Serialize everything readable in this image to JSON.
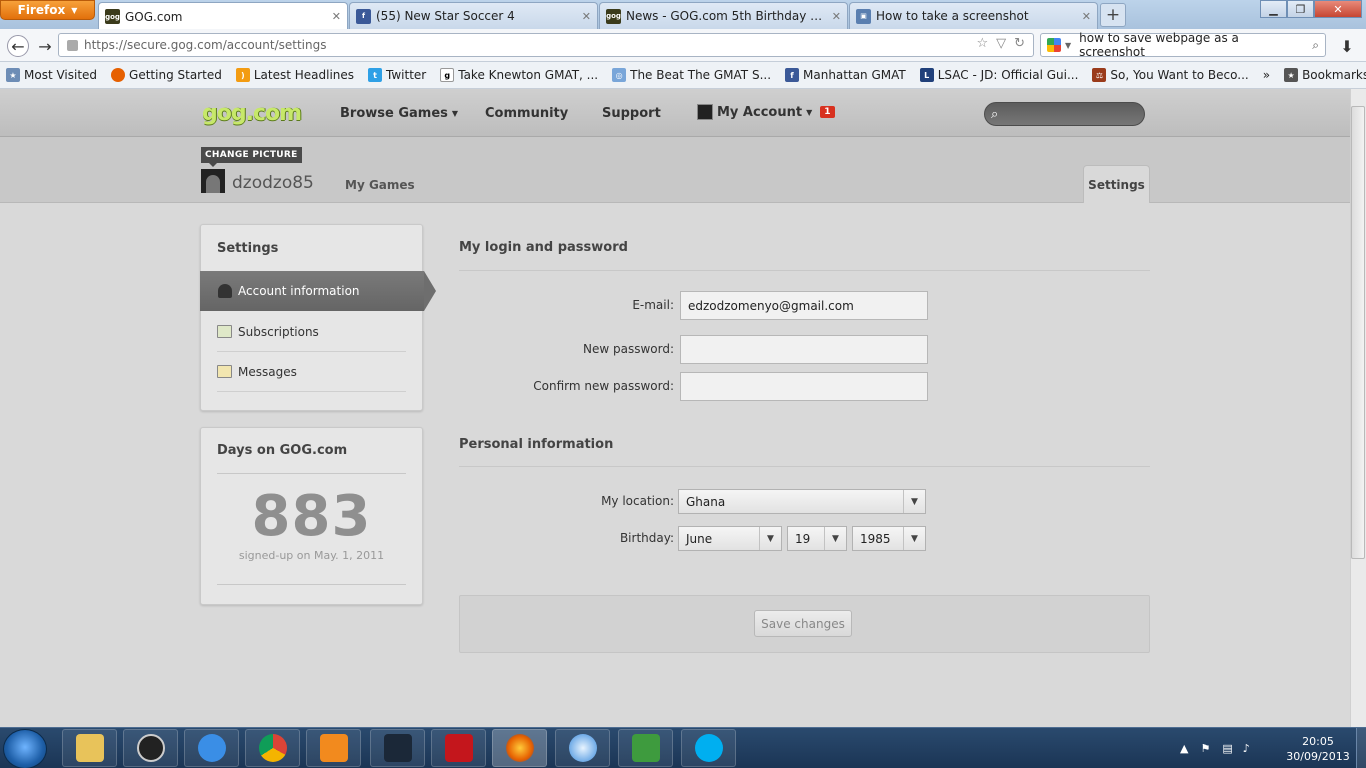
{
  "browser": {
    "menu_label": "Firefox",
    "tabs": [
      {
        "label": "GOG.com",
        "active": true
      },
      {
        "label": "(55) New Star Soccer 4",
        "active": false
      },
      {
        "label": "News - GOG.com 5th Birthday Givea...",
        "active": false
      },
      {
        "label": "How to take a screenshot",
        "active": false
      }
    ],
    "url": "https://secure.gog.com/account/settings",
    "search_text": "how to save webpage as a screenshot",
    "bookmarks": [
      "Most Visited",
      "Getting Started",
      "Latest Headlines",
      "Twitter",
      "Take Knewton GMAT, ...",
      "The Beat The GMAT S...",
      "Manhattan GMAT",
      "LSAC - JD: Official Gui...",
      "So, You Want to Beco..."
    ],
    "bookmarks_menu": "Bookmarks"
  },
  "site": {
    "logo": "gog.com",
    "nav": {
      "browse_games": "Browse Games",
      "community": "Community",
      "support": "Support",
      "my_account": "My Account",
      "notifications": "1"
    }
  },
  "profile": {
    "change_picture": "CHANGE PICTURE",
    "username": "dzodzo85",
    "my_games": "My Games",
    "settings_tab": "Settings"
  },
  "sidebar": {
    "title": "Settings",
    "items": [
      {
        "label": "Account information",
        "active": true
      },
      {
        "label": "Subscriptions",
        "active": false
      },
      {
        "label": "Messages",
        "active": false
      }
    ]
  },
  "days": {
    "title": "Days on GOG.com",
    "count": "883",
    "signed_up": "signed-up on May. 1, 2011"
  },
  "login": {
    "title": "My login and password",
    "email_label": "E-mail:",
    "email_value": "edzodzomenyo@gmail.com",
    "new_password_label": "New password:",
    "confirm_password_label": "Confirm new password:"
  },
  "personal": {
    "title": "Personal information",
    "location_label": "My location:",
    "location_value": "Ghana",
    "birthday_label": "Birthday:",
    "month": "June",
    "day": "19",
    "year": "1985"
  },
  "save_label": "Save changes",
  "taskbar": {
    "time": "20:05",
    "date": "30/09/2013"
  },
  "colors": {
    "logo_green": "#c7e86a",
    "badge_red": "#d8311f",
    "taskbar": "#1b3555"
  }
}
